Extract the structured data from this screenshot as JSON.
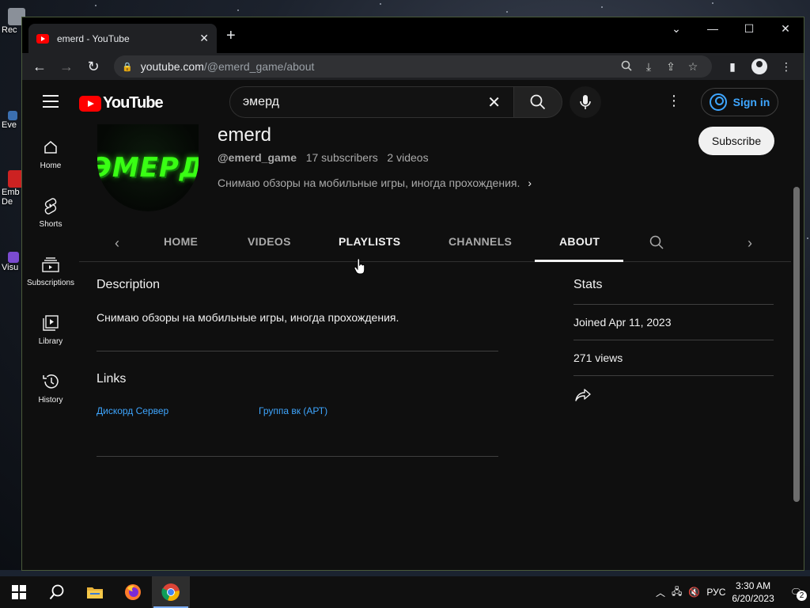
{
  "desktop": {
    "icons": [
      "Rec",
      "Eve",
      "Emb De",
      "Visu"
    ]
  },
  "browser": {
    "tab_title": "emerd - YouTube",
    "url_domain": "youtube.com",
    "url_path": "/@emerd_game/about"
  },
  "youtube": {
    "logo_text": "YouTube",
    "search_query": "эмерд",
    "signin_label": "Sign in",
    "guide": [
      {
        "label": "Home",
        "icon": "home-icon"
      },
      {
        "label": "Shorts",
        "icon": "shorts-icon"
      },
      {
        "label": "Subscriptions",
        "icon": "subscriptions-icon"
      },
      {
        "label": "Library",
        "icon": "library-icon"
      },
      {
        "label": "History",
        "icon": "history-icon"
      }
    ],
    "channel": {
      "name": "emerd",
      "handle": "@emerd_game",
      "subscribers": "17 subscribers",
      "videos": "2 videos",
      "tagline": "Снимаю обзоры на мобильные игры, иногда прохождения.",
      "avatar_text": "ЭМЕРД",
      "subscribe_label": "Subscribe"
    },
    "tabs": [
      {
        "label": "HOME"
      },
      {
        "label": "VIDEOS"
      },
      {
        "label": "PLAYLISTS"
      },
      {
        "label": "CHANNELS"
      },
      {
        "label": "ABOUT"
      }
    ],
    "active_tab": "ABOUT",
    "about": {
      "description_title": "Description",
      "description_text": "Снимаю обзоры на мобильные игры, иногда прохождения.",
      "links_title": "Links",
      "links": [
        "Дискорд Сервер",
        "Группа вк (АРТ)"
      ],
      "stats_title": "Stats",
      "joined": "Joined Apr 11, 2023",
      "views": "271 views"
    }
  },
  "taskbar": {
    "language": "РУС",
    "time": "3:30 AM",
    "date": "6/20/2023",
    "notifications": "2"
  },
  "colors": {
    "accent_blue": "#3ea6ff",
    "yt_red": "#ff0000",
    "avatar_green": "#39ff14"
  }
}
